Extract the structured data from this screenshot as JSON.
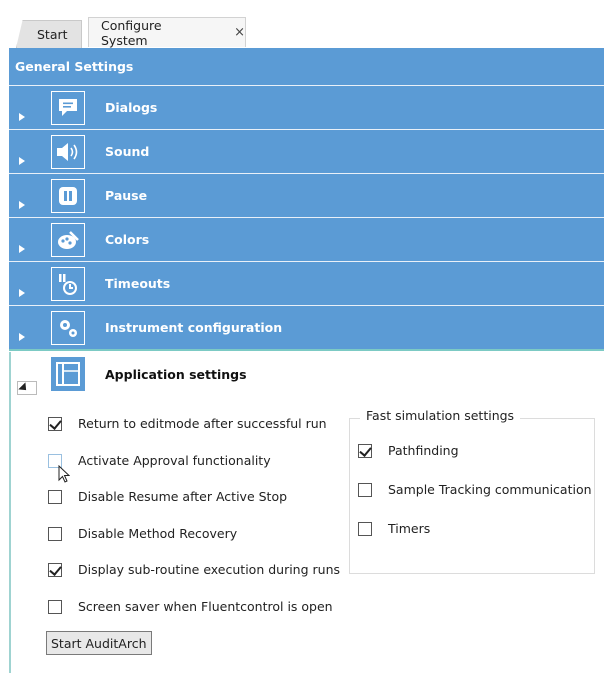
{
  "tabs": [
    {
      "label": "Start"
    },
    {
      "label": "Configure System",
      "close": "×"
    }
  ],
  "general_settings": {
    "title": "General Settings"
  },
  "sections": [
    {
      "label": "Dialogs",
      "icon": "speech-bubble-icon"
    },
    {
      "label": "Sound",
      "icon": "speaker-icon"
    },
    {
      "label": "Pause",
      "icon": "pause-icon"
    },
    {
      "label": "Colors",
      "icon": "palette-icon"
    },
    {
      "label": "Timeouts",
      "icon": "timer-icon"
    },
    {
      "label": "Instrument configuration",
      "icon": "gears-icon"
    }
  ],
  "application_settings": {
    "label": "Application settings",
    "icon": "window-layout-icon",
    "options": [
      {
        "label": "Return to editmode after successful run",
        "checked": true
      },
      {
        "label": "Activate Approval functionality",
        "checked": false
      },
      {
        "label": "Disable Resume after Active Stop",
        "checked": false
      },
      {
        "label": "Disable Method Recovery",
        "checked": false
      },
      {
        "label": "Display sub-routine execution during runs",
        "checked": true
      },
      {
        "label": "Screen saver when Fluentcontrol is open",
        "checked": false
      }
    ],
    "fast_simulation": {
      "title": "Fast simulation settings",
      "options": [
        {
          "label": "Pathfinding",
          "checked": true
        },
        {
          "label": "Sample Tracking communication",
          "checked": false
        },
        {
          "label": "Timers",
          "checked": false
        }
      ]
    },
    "button_label": "Start AuditArch"
  },
  "colors": {
    "header_blue": "#5b9bd5",
    "accent_teal": "#7ccac4"
  }
}
